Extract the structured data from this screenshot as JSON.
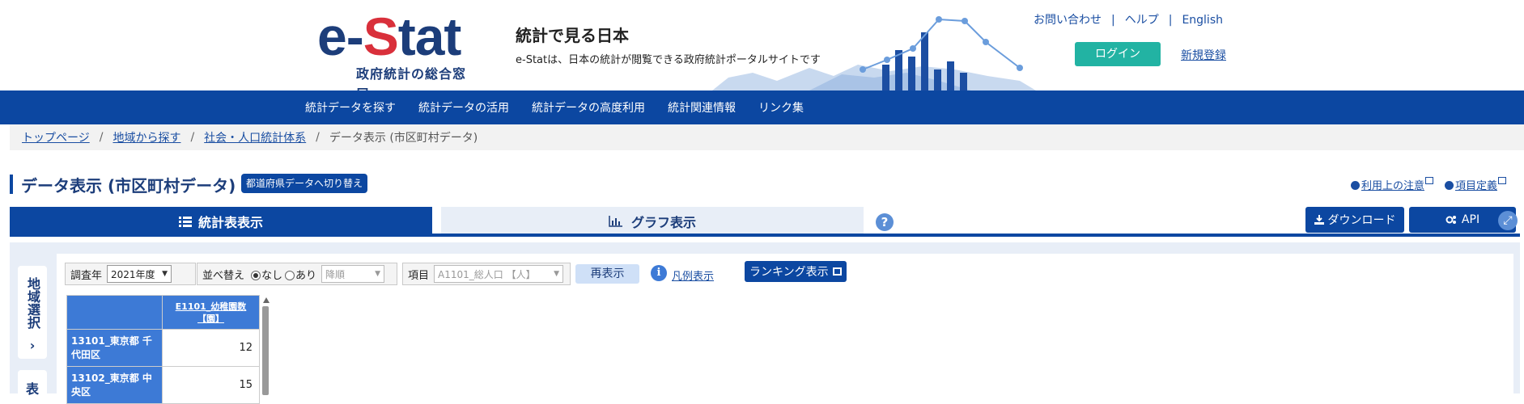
{
  "header": {
    "logo_text_pre": "e-",
    "logo_text_s": "S",
    "logo_text_post": "tat",
    "logo_subtitle": "政府統計の総合窓口",
    "tagline_title": "統計で見る日本",
    "tagline_desc": "e-Statは、日本の統計が閲覧できる政府統計ポータルサイトです",
    "links": {
      "contact": "お問い合わせ",
      "help": "ヘルプ",
      "english": "English"
    },
    "login_label": "ログイン",
    "register_label": "新規登録"
  },
  "nav": {
    "items": [
      {
        "label": "統計データを探す"
      },
      {
        "label": "統計データの活用"
      },
      {
        "label": "統計データの高度利用"
      },
      {
        "label": "統計関連情報"
      },
      {
        "label": "リンク集"
      }
    ]
  },
  "breadcrumb": {
    "items": [
      {
        "label": "トップページ"
      },
      {
        "label": "地域から探す"
      },
      {
        "label": "社会・人口統計体系"
      }
    ],
    "current": "データ表示 (市区町村データ)"
  },
  "page": {
    "title": "データ表示 (市区町村データ)",
    "switch_label": "都道府県データへ切り替え",
    "terms_link": "利用上の注意",
    "definitions_link": "項目定義"
  },
  "tabs": {
    "table_label": "統計表表示",
    "graph_label": "グラフ表示",
    "active": "統計表表示"
  },
  "toolbar": {
    "help_label": "?",
    "download_label": "ダウンロード",
    "api_label": "API",
    "expand_label": "⤢"
  },
  "sidebar": {
    "region_tab": "地域選択",
    "display_tab": "表"
  },
  "controls": {
    "year_label": "調査年",
    "year_value": "2021年度",
    "sort_label": "並べ替え",
    "sort_none": "なし",
    "sort_some": "あり",
    "sort_selected": "なし",
    "order_value": "降順",
    "item_label": "項目",
    "item_value": "A1101_総人口 【人】",
    "redisplay_label": "再表示",
    "legend_label": "凡例表示",
    "ranking_label": "ランキング表示"
  },
  "table": {
    "column_header": "E1101_幼稚園数【園】",
    "rows": [
      {
        "region": "13101_東京都 千代田区",
        "value": "12"
      },
      {
        "region": "13102_東京都 中央区",
        "value": "15"
      }
    ]
  },
  "colors": {
    "brand_blue": "#0c47a1",
    "logo_red": "#d9303b",
    "login_teal": "#22b3a3",
    "table_header": "#3d7ad6"
  }
}
